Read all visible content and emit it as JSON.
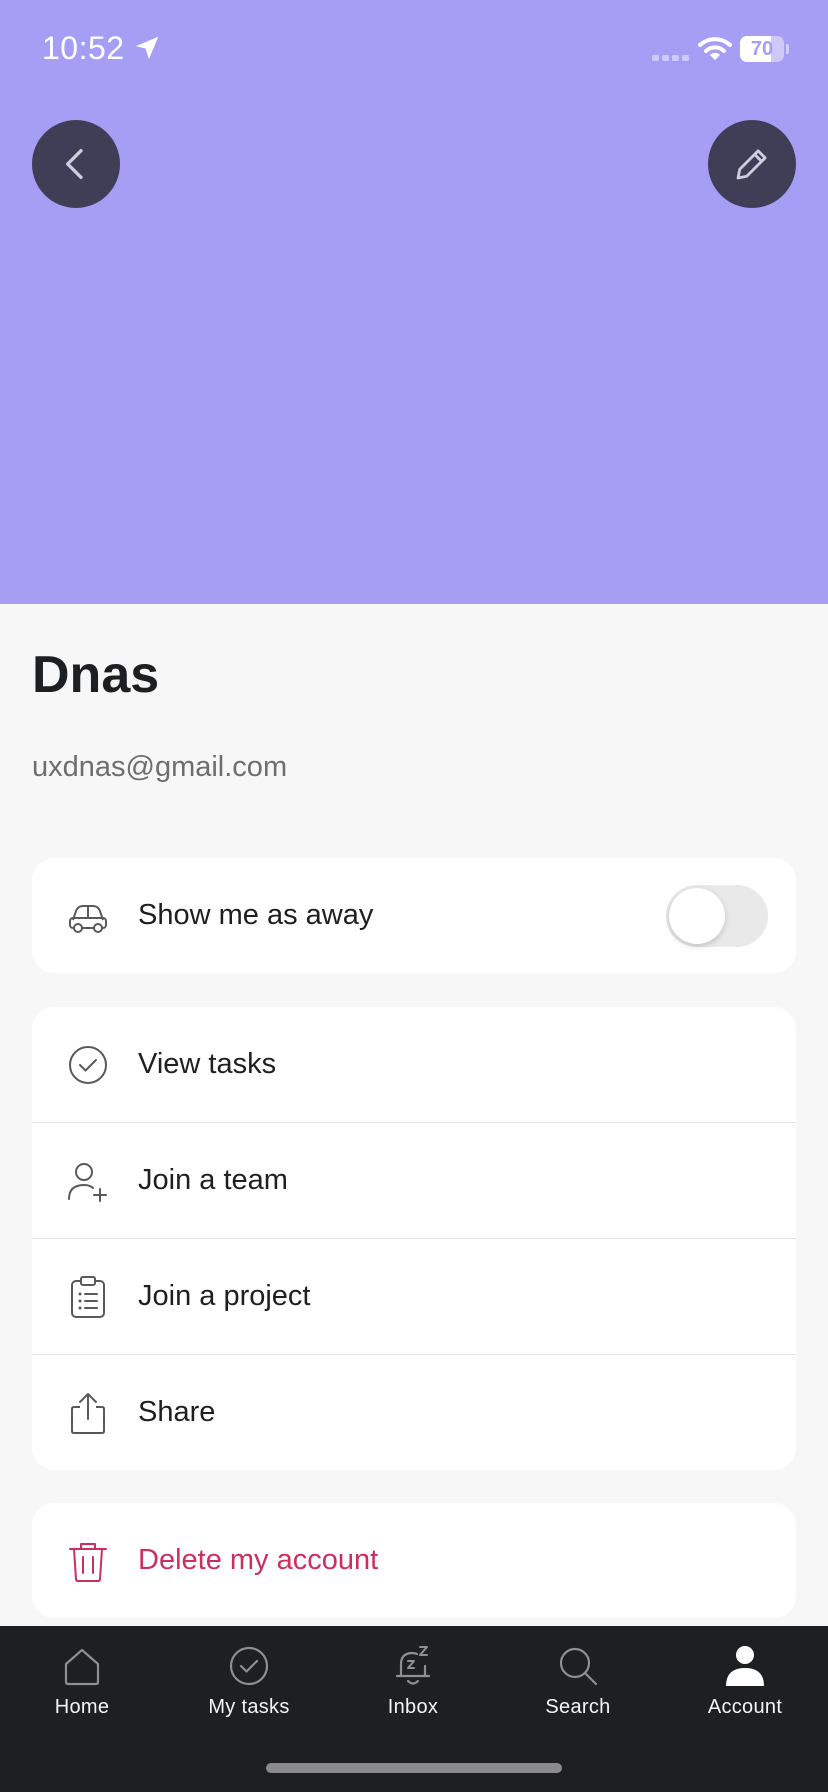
{
  "status_bar": {
    "time": "10:52",
    "battery_level": "70",
    "battery_fraction": 0.7
  },
  "header": {
    "background_color": "#a59ef4",
    "back_icon": "chevron-left-icon",
    "edit_icon": "pencil-icon"
  },
  "profile": {
    "name": "Dnas",
    "email": "uxdnas@gmail.com"
  },
  "away": {
    "label": "Show me as away",
    "icon": "car-icon",
    "enabled": false
  },
  "menu": {
    "items": [
      {
        "label": "View tasks",
        "icon": "check-circle-icon"
      },
      {
        "label": "Join a team",
        "icon": "user-plus-icon"
      },
      {
        "label": "Join a project",
        "icon": "clipboard-list-icon"
      },
      {
        "label": "Share",
        "icon": "share-icon"
      }
    ]
  },
  "danger": {
    "label": "Delete my account",
    "icon": "trash-icon",
    "color": "#c92f5f"
  },
  "tab_bar": {
    "tabs": [
      {
        "label": "Home",
        "icon": "home-icon"
      },
      {
        "label": "My tasks",
        "icon": "check-circle-icon"
      },
      {
        "label": "Inbox",
        "icon": "bell-snooze-icon"
      },
      {
        "label": "Search",
        "icon": "search-icon"
      },
      {
        "label": "Account",
        "icon": "user-icon",
        "active": true
      }
    ]
  }
}
